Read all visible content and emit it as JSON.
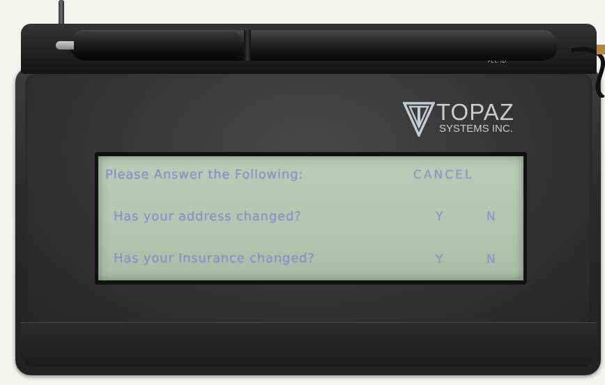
{
  "device": {
    "brand": "TOPAZ",
    "brand_sub": "SYSTEMS INC.",
    "fcc_label": "FCC ID",
    "colors": {
      "lcd_background": "#b3c8b0",
      "lcd_text": "#8a8fd0",
      "body": "#2a2a2a"
    }
  },
  "lcd": {
    "header": "Please Answer the Following:",
    "cancel": "CANCEL",
    "questions": [
      {
        "text": "Has your address changed?",
        "yes": "Y",
        "no": "N"
      },
      {
        "text": "Has your Insurance changed?",
        "yes": "Y",
        "no": "N"
      }
    ]
  }
}
